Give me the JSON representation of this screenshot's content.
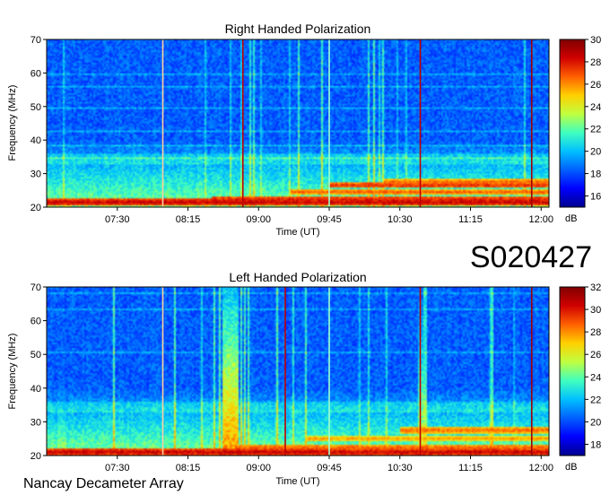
{
  "observation_code": "S020427",
  "credit": "Nancay Decameter Array",
  "colors": {
    "colormap": [
      "#00008f",
      "#0000ff",
      "#0060ff",
      "#00c0ff",
      "#40ffbf",
      "#bfff40",
      "#ffd000",
      "#ff6000",
      "#d00000",
      "#800000"
    ],
    "background": "#ffffff",
    "frame": "#000000"
  },
  "chart_data": [
    {
      "type": "heatmap",
      "title": "Right Handed Polarization",
      "xlabel": "Time (UT)",
      "ylabel": "Frequency (MHz)",
      "x_ticks": [
        "07:30",
        "08:15",
        "09:00",
        "09:45",
        "10:30",
        "11:15",
        "12:00"
      ],
      "y_ticks": [
        20,
        30,
        40,
        50,
        60,
        70
      ],
      "ylim": [
        20,
        70
      ],
      "colorbar": {
        "label": "dB",
        "ticks": [
          16,
          18,
          20,
          22,
          24,
          26,
          28,
          30
        ],
        "range": [
          15,
          30
        ]
      },
      "vertical_lines": [
        {
          "time": "07:59",
          "color": "#ffd0a0"
        },
        {
          "time": "08:50",
          "color": "#c00000"
        },
        {
          "time": "09:45",
          "color": "#a0ffd0"
        },
        {
          "time": "10:43",
          "color": "#c00000"
        },
        {
          "time": "11:54",
          "color": "#a00000"
        }
      ],
      "bands": [
        {
          "freq": 21.5,
          "start": "06:45",
          "end": "12:05",
          "level": 28
        },
        {
          "freq": 22.5,
          "start": "08:30",
          "end": "12:05",
          "level": 27
        },
        {
          "freq": 24.5,
          "start": "09:20",
          "end": "12:05",
          "level": 26
        },
        {
          "freq": 26.5,
          "start": "09:45",
          "end": "12:05",
          "level": 27
        },
        {
          "freq": 27.5,
          "start": "10:20",
          "end": "12:05",
          "level": 26
        }
      ]
    },
    {
      "type": "heatmap",
      "title": "Left Handed Polarization",
      "xlabel": "Time (UT)",
      "ylabel": "Frequency (MHz)",
      "x_ticks": [
        "07:30",
        "08:15",
        "09:00",
        "09:45",
        "10:30",
        "11:15",
        "12:00"
      ],
      "y_ticks": [
        20,
        30,
        40,
        50,
        60,
        70
      ],
      "ylim": [
        20,
        70
      ],
      "colorbar": {
        "label": "dB",
        "ticks": [
          18,
          20,
          22,
          24,
          26,
          28,
          30,
          32
        ],
        "range": [
          17,
          32
        ]
      },
      "vertical_lines": [
        {
          "time": "07:59",
          "color": "#ffd0a0"
        },
        {
          "time": "09:17",
          "color": "#c00000"
        },
        {
          "time": "09:45",
          "color": "#a0ffd0"
        },
        {
          "time": "10:43",
          "color": "#c00000"
        },
        {
          "time": "11:54",
          "color": "#a00000"
        }
      ],
      "bands": [
        {
          "freq": 21.0,
          "start": "06:45",
          "end": "12:05",
          "level": 30
        },
        {
          "freq": 22.5,
          "start": "08:45",
          "end": "12:05",
          "level": 28
        },
        {
          "freq": 25.0,
          "start": "09:30",
          "end": "12:05",
          "level": 27
        },
        {
          "freq": 27.5,
          "start": "10:30",
          "end": "12:05",
          "level": 28
        }
      ],
      "bursts": [
        {
          "start": "08:37",
          "end": "08:47",
          "fmin": 20,
          "fmax": 70,
          "level": 27
        },
        {
          "start": "06:52",
          "end": "06:58",
          "fmin": 20,
          "fmax": 45,
          "level": 24
        },
        {
          "start": "10:42",
          "end": "10:47",
          "fmin": 20,
          "fmax": 70,
          "level": 25
        }
      ]
    }
  ]
}
